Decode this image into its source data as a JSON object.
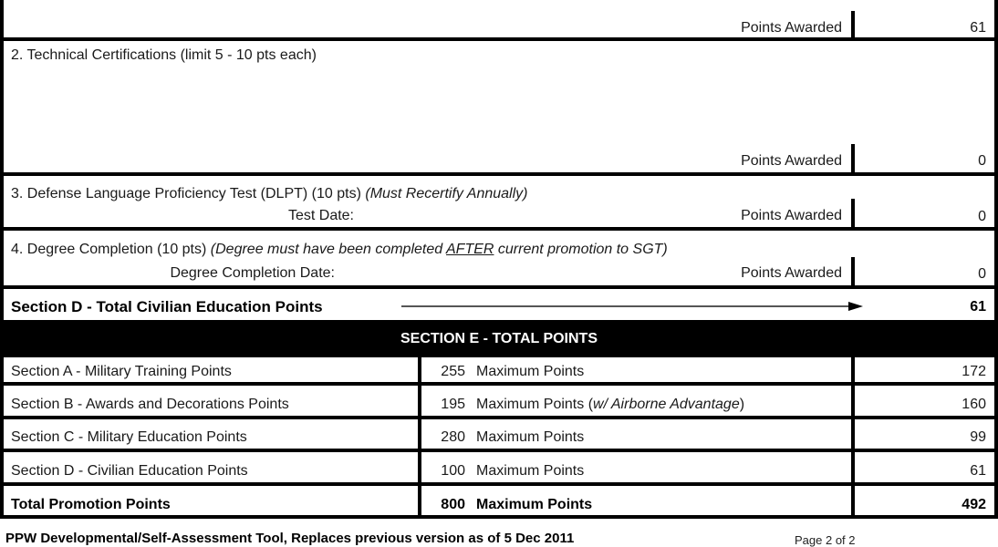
{
  "section_d": {
    "item1": {
      "points_label": "Points Awarded",
      "points_value": "61"
    },
    "item2": {
      "title": "2.  Technical Certifications (limit 5 - 10 pts each)",
      "points_label": "Points Awarded",
      "points_value": "0"
    },
    "item3": {
      "title": "3.  Defense Language Proficiency Test (DLPT) (10 pts)",
      "note": "(Must Recertify Annually)",
      "date_label": "Test Date:",
      "points_label": "Points Awarded",
      "points_value": "0"
    },
    "item4": {
      "title": "4.  Degree Completion (10 pts)",
      "note_prefix": "(Degree must have been completed ",
      "note_emphasis": "AFTER",
      "note_suffix": " current promotion to SGT)",
      "date_label": "Degree Completion Date:",
      "points_label": "Points Awarded",
      "points_value": "0"
    },
    "total": {
      "label": "Section D - Total Civilian Education Points",
      "value": "61",
      "arrow_icon": "right-arrow"
    }
  },
  "section_e": {
    "title": "SECTION E - TOTAL POINTS",
    "rows": [
      {
        "label": "Section A - Military Training Points",
        "max": "255",
        "max_label": "Maximum Points",
        "note": "",
        "value": "172"
      },
      {
        "label": "Section B - Awards and Decorations Points",
        "max": "195",
        "max_label": "Maximum Points (",
        "note": "w/ Airborne Advantage",
        "note_close": ")",
        "value": "160"
      },
      {
        "label": "Section C - Military Education Points",
        "max": "280",
        "max_label": "Maximum Points",
        "note": "",
        "value": "99"
      },
      {
        "label": "Section D - Civilian Education Points",
        "max": "100",
        "max_label": "Maximum Points",
        "note": "",
        "value": "61"
      }
    ],
    "total": {
      "label": "Total Promotion Points",
      "max": "800",
      "max_label": "Maximum Points",
      "value": "492"
    }
  },
  "footer": {
    "tool_name": "PPW Developmental/Self-Assessment Tool, Replaces previous version as of 5 Dec 2011",
    "page": "Page 2 of 2"
  }
}
